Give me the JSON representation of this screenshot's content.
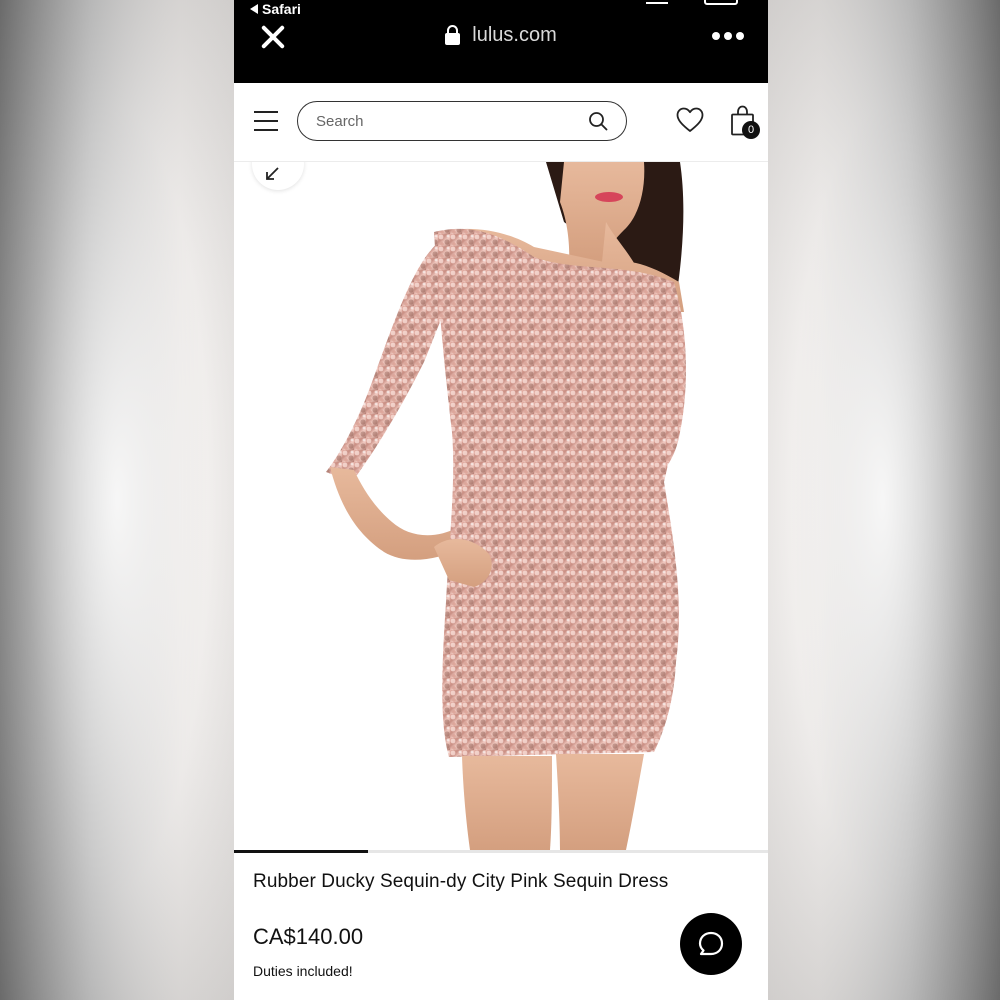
{
  "browser": {
    "back_app_label": "Safari",
    "url": "lulus.com"
  },
  "header": {
    "search_placeholder": "Search",
    "cart_count": "0"
  },
  "product": {
    "title": "Rubber Ducky Sequin-dy City Pink Sequin Dress",
    "price": "CA$140.00",
    "duties_note": "Duties included!",
    "carousel_progress": 0.25
  },
  "icons": {
    "close": "close-icon",
    "lock": "lock-icon",
    "more": "more-icon",
    "menu": "hamburger-menu-icon",
    "search": "search-icon",
    "wishlist": "heart-icon",
    "cart": "shopping-bag-icon",
    "collapse": "collapse-arrow-icon",
    "chat": "chat-bubble-icon"
  },
  "colors": {
    "browser_bar": "#000000",
    "text": "#111111",
    "dress": "#c98f84"
  }
}
